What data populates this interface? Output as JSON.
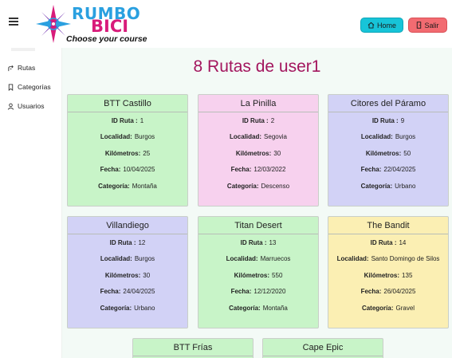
{
  "logo": {
    "word1": "RUMBO",
    "word2": "BICI",
    "tagline": "Choose your course"
  },
  "header": {
    "home_label": "Home",
    "exit_label": "Salir"
  },
  "sidebar": {
    "items": [
      {
        "label": "Rutas",
        "icon": "route-icon"
      },
      {
        "label": "Categorías",
        "icon": "bookmark-icon"
      },
      {
        "label": "Usuarios",
        "icon": "user-icon"
      }
    ]
  },
  "main": {
    "title": "8 Rutas de user1"
  },
  "field_labels": {
    "id": "ID Ruta :",
    "localidad": "Localidad:",
    "km": "Kilómetros:",
    "fecha": "Fecha:",
    "categoria": "Categoría:"
  },
  "routes": [
    {
      "name": "BTT Castillo",
      "id": "1",
      "localidad": "Burgos",
      "km": "25",
      "fecha": "10/04/2025",
      "categoria": "Montaña",
      "color": "#c8f4c8"
    },
    {
      "name": "La Pinilla",
      "id": "2",
      "localidad": "Segovia",
      "km": "30",
      "fecha": "12/03/2022",
      "categoria": "Descenso",
      "color": "#f7d1ee"
    },
    {
      "name": "Citores del Páramo",
      "id": "9",
      "localidad": "Burgos",
      "km": "50",
      "fecha": "22/04/2025",
      "categoria": "Urbano",
      "color": "#d2d2f6"
    },
    {
      "name": "Villandiego",
      "id": "12",
      "localidad": "Burgos",
      "km": "30",
      "fecha": "24/04/2025",
      "categoria": "Urbano",
      "color": "#d2d2f6"
    },
    {
      "name": "Titan Desert",
      "id": "13",
      "localidad": "Marruecos",
      "km": "550",
      "fecha": "12/12/2020",
      "categoria": "Montaña",
      "color": "#c8f4c8"
    },
    {
      "name": "The Bandit",
      "id": "14",
      "localidad": "Santo Domingo de Silos",
      "km": "135",
      "fecha": "26/04/2025",
      "categoria": "Gravel",
      "color": "#fbefb3"
    },
    {
      "name": "BTT Frías",
      "color": "#c8f4c8"
    },
    {
      "name": "Cape Epic",
      "color": "#c8f4c8"
    }
  ]
}
